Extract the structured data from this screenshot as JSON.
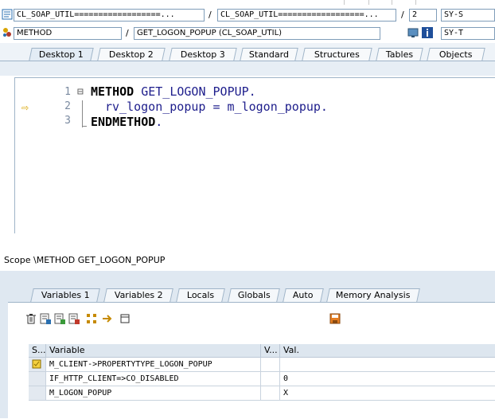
{
  "header": {
    "row1": {
      "field1": "CL_SOAP_UTIL==================...",
      "field2": "CL_SOAP_UTIL==================...",
      "field3": "2",
      "field4": "SY-S"
    },
    "row2": {
      "field1": "METHOD",
      "field2": "GET_LOGON_POPUP (CL_SOAP_UTIL)",
      "field4": "SY-T"
    },
    "sep": "/"
  },
  "desktop_tabs": [
    "Desktop 1",
    "Desktop 2",
    "Desktop 3",
    "Standard",
    "Structures",
    "Tables",
    "Objects"
  ],
  "editor": {
    "lines": [
      {
        "num": "1",
        "keyword": "METHOD",
        "rest": " GET_LOGON_POPUP."
      },
      {
        "num": "2",
        "keyword": "",
        "rest": "rv_logon_popup = m_logon_popup."
      },
      {
        "num": "3",
        "keyword": "ENDMETHOD",
        "rest": "."
      }
    ],
    "fold_marker": "⊟"
  },
  "scope_text": "Scope \\METHOD GET_LOGON_POPUP",
  "lower_tabs": [
    "Variables 1",
    "Variables 2",
    "Locals",
    "Globals",
    "Auto",
    "Memory Analysis"
  ],
  "grid": {
    "headers": {
      "s": "S...",
      "variable": "Variable",
      "v": "V...",
      "val": "Val."
    },
    "rows": [
      {
        "variable": "M_CLIENT->PROPERTYTYPE_LOGON_POPUP",
        "v": "",
        "val": ""
      },
      {
        "variable": "IF_HTTP_CLIENT=>CO_DISABLED",
        "v": "",
        "val": "0"
      },
      {
        "variable": "M_LOGON_POPUP",
        "v": "",
        "val": "X"
      }
    ]
  },
  "colors": {
    "accent": "#9fb4c8",
    "code_text": "#1e1e8c",
    "arrow": "#d9a400"
  }
}
